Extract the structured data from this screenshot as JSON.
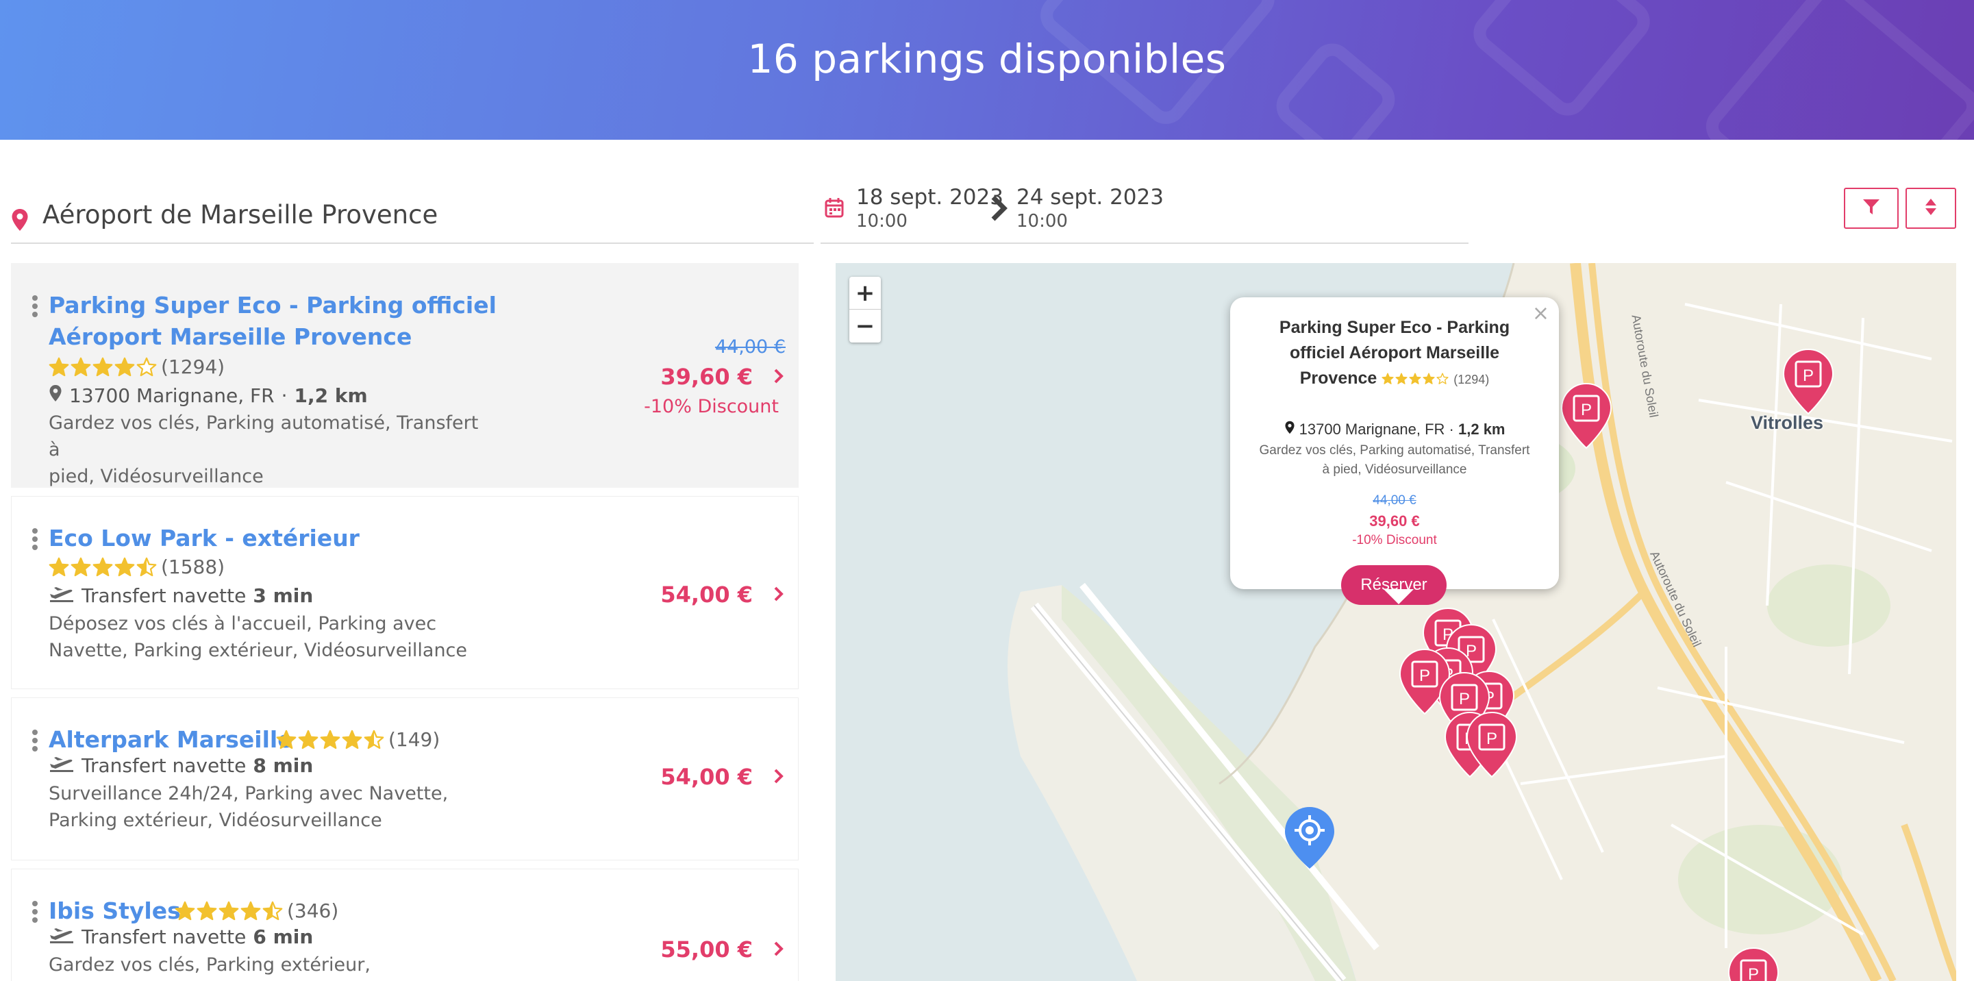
{
  "header": {
    "title": "16 parkings disponibles"
  },
  "search": {
    "location": "Aéroport de Marseille Provence",
    "start_date": "18 sept. 2023",
    "start_time": "10:00",
    "end_date": "24 sept. 2023",
    "end_time": "10:00",
    "filter_icon": "filter-icon",
    "sort_icon": "sort-icon"
  },
  "colors": {
    "accent": "#e23d6a",
    "link": "#4f8fe6",
    "star": "#f2c12e",
    "reserve": "#d7306b"
  },
  "results": [
    {
      "name_line1": "Parking Super Eco - Parking officiel",
      "name_line2": "Aéroport Marseille Provence",
      "rating": 4,
      "reviews": "(1294)",
      "address": "13700 Marignane, FR",
      "distance": "1,2 km",
      "desc_line1": "Gardez vos clés, Parking automatisé, Transfert à",
      "desc_line2": "pied, Vidéosurveillance",
      "old_price": "44,00 €",
      "price": "39,60 €",
      "discount": "-10% Discount"
    },
    {
      "name_line1": "Eco Low Park - extérieur",
      "rating": 4.5,
      "reviews": "(1588)",
      "shuttle_label": "Transfert navette",
      "shuttle_time": "3 min",
      "desc_line1": "Déposez vos clés à l'accueil, Parking avec",
      "desc_line2": "Navette, Parking extérieur, Vidéosurveillance",
      "price": "54,00 €"
    },
    {
      "name_line1": "Alterpark Marseille",
      "rating": 4.5,
      "reviews": "(149)",
      "shuttle_label": "Transfert navette",
      "shuttle_time": "8 min",
      "desc_line1": "Surveillance 24h/24, Parking avec Navette,",
      "desc_line2": "Parking extérieur, Vidéosurveillance",
      "price": "54,00 €"
    },
    {
      "name_line1": "Ibis Styles",
      "rating": 4.5,
      "reviews": "(346)",
      "shuttle_label": "Transfert navette",
      "shuttle_time": "6 min",
      "desc_line1": "Gardez vos clés, Parking extérieur,",
      "price": "55,00 €"
    }
  ],
  "map": {
    "zoom_in": "+",
    "zoom_out": "−",
    "town": "Vitrolles",
    "road_1": "Autoroute du Soleil",
    "road_2": "Autoroute du Soleil",
    "popup": {
      "close": "×",
      "title_line1": "Parking Super Eco - Parking",
      "title_line2": "officiel Aéroport Marseille",
      "title_line3": "Provence",
      "reviews": "(1294)",
      "address": "13700 Marignane, FR",
      "distance": "1,2 km",
      "desc_line1": "Gardez vos clés, Parking automatisé, Transfert",
      "desc_line2": "à pied, Vidéosurveillance",
      "old_price": "44,00 €",
      "price": "39,60 €",
      "discount": "-10% Discount",
      "button": "Réserver"
    },
    "marker_label": "P"
  }
}
